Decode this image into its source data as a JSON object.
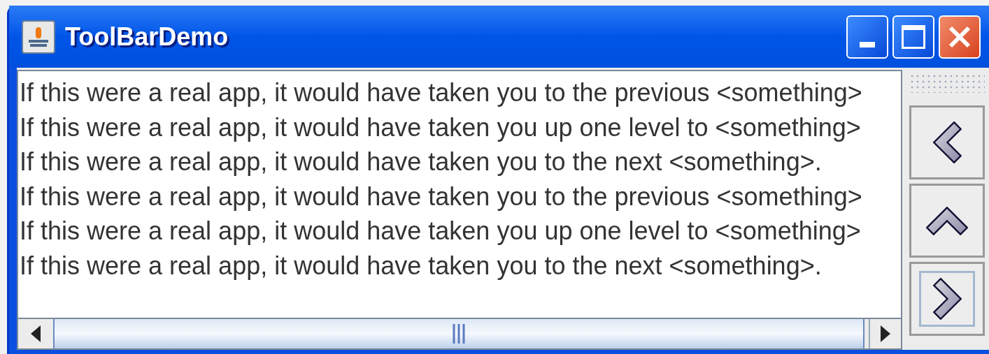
{
  "window": {
    "title": "ToolBarDemo"
  },
  "text_area": {
    "lines": [
      "If this were a real app, it would have taken you to the previous <something>",
      "If this were a real app, it would have taken you up one level to <something>",
      "If this were a real app, it would have taken you to the next <something>.",
      "If this were a real app, it would have taken you to the previous <something>",
      "If this were a real app, it would have taken you up one level to <something>",
      "If this were a real app, it would have taken you to the next <something>."
    ]
  },
  "toolbar": {
    "buttons": [
      {
        "kind": "back",
        "focused": false
      },
      {
        "kind": "up",
        "focused": false
      },
      {
        "kind": "forward",
        "focused": true
      }
    ]
  }
}
